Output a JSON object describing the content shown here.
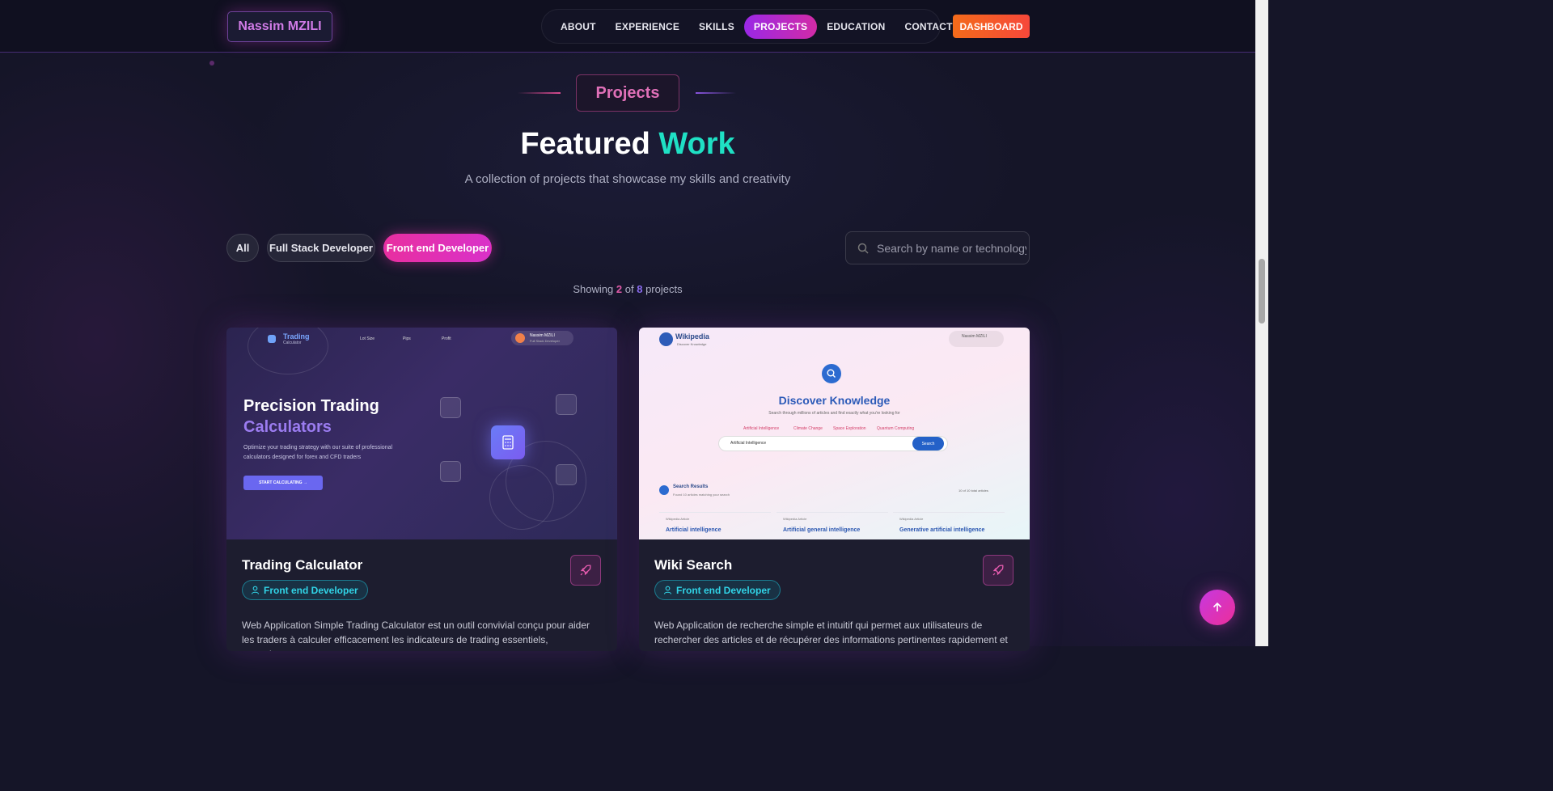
{
  "nav": {
    "brand": "Nassim MZILI",
    "items": [
      {
        "label": "ABOUT"
      },
      {
        "label": "EXPERIENCE"
      },
      {
        "label": "SKILLS"
      },
      {
        "label": "PROJECTS"
      },
      {
        "label": "EDUCATION"
      },
      {
        "label": "CONTACT"
      }
    ],
    "active_item": "PROJECTS",
    "dashboard_label": "DASHBOARD"
  },
  "section": {
    "tag": "Projects",
    "title_main": "Featured",
    "title_accent": "Work",
    "subtitle": "A collection of projects that showcase my skills and creativity"
  },
  "filters": {
    "items": [
      {
        "label": "All"
      },
      {
        "label": "Full Stack Developer"
      },
      {
        "label": "Front end Developer"
      }
    ],
    "active": "Front end Developer"
  },
  "search": {
    "placeholder": "Search by name or technology..."
  },
  "showing": {
    "prefix": "Showing",
    "shown": "2",
    "of": "of",
    "total": "8",
    "suffix": "projects"
  },
  "projects": [
    {
      "title": "Trading Calculator",
      "category": "Front end Developer",
      "description": "Web Application Simple Trading Calculator est un outil convivial conçu pour aider les traders à calculer efficacement les indicateurs de trading essentiels, garantissant une",
      "preview": {
        "brand": "Trading",
        "brand_sub": "Calculator",
        "nav": [
          "Lot Size",
          "Pips",
          "Profit"
        ],
        "user_name": "Nassim MZILI",
        "user_role": "Full Stack Developer",
        "headline": "Precision Trading",
        "headline_accent": "Calculators",
        "text": "Optimize your trading strategy with our suite of professional calculators designed for forex and CFD traders",
        "button": "START CALCULATING →"
      }
    },
    {
      "title": "Wiki Search",
      "category": "Front end Developer",
      "description": "Web Application de recherche simple et intuitif qui permet aux utilisateurs de rechercher des articles et de récupérer des informations pertinentes rapidement et",
      "preview": {
        "brand": "Wikipedia",
        "brand_sub": "Discover Knowledge",
        "user_name": "Nassim MZILI",
        "headline": "Discover Knowledge",
        "text": "Search through millions of articles and find exactly what you're looking for",
        "tags": [
          "Artificial Intelligence",
          "Climate Change",
          "Space Exploration",
          "Quantum Computing"
        ],
        "query": "Artificial Intelligence",
        "search_button": "Search",
        "results_title": "Search Results",
        "results_sub": "Found 10 articles matching your search",
        "results_right": "10 of 10 total articles",
        "result_cards": [
          {
            "meta": "Wikipedia Article",
            "title": "Artificial intelligence"
          },
          {
            "meta": "Wikipedia Article",
            "title": "Artificial general intelligence"
          },
          {
            "meta": "Wikipedia Article",
            "title": "Generative artificial intelligence"
          }
        ]
      }
    }
  ],
  "colors": {
    "accent_pink": "#e82fa0",
    "accent_teal": "#1fe0c4",
    "accent_orange": "#f46b1a",
    "badge_cyan": "#31d3e6"
  },
  "icons": {
    "search": "search-icon",
    "user": "user-icon",
    "rocket": "rocket-icon",
    "arrow_up": "arrow-up-icon"
  }
}
